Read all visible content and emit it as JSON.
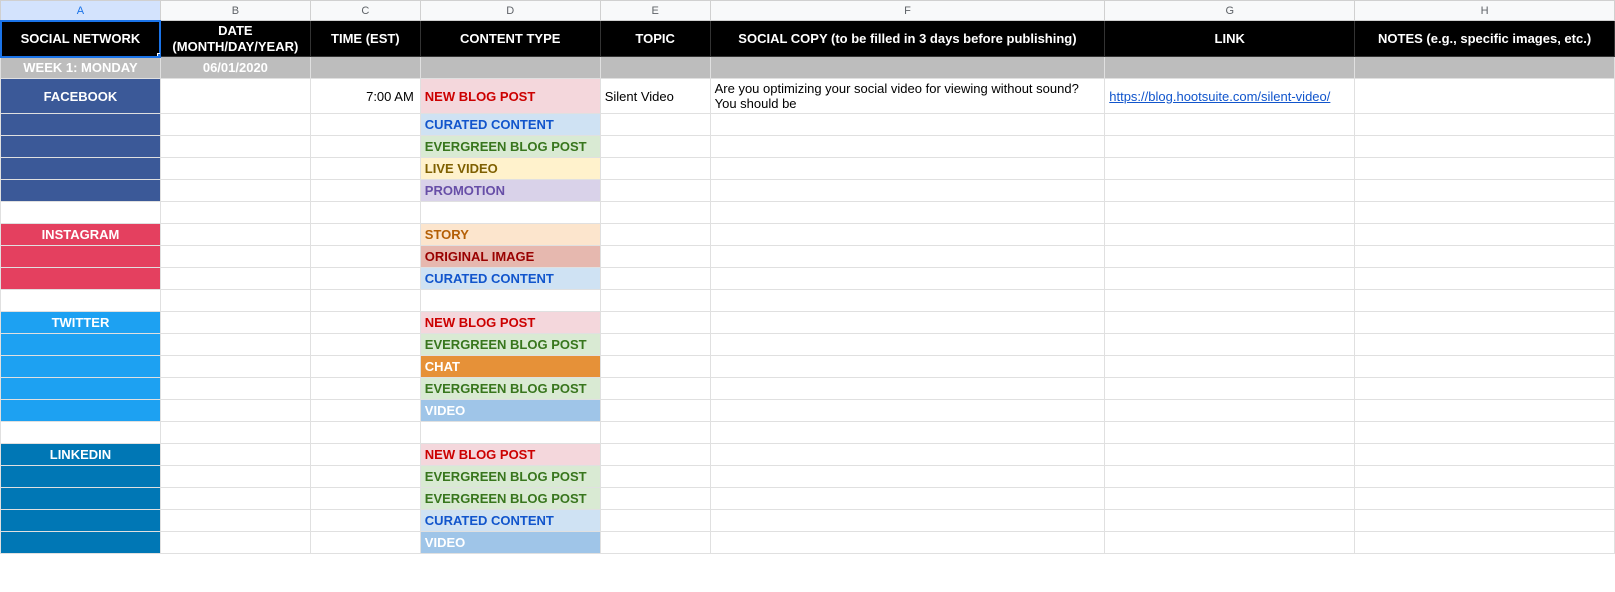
{
  "columns": {
    "A": "A",
    "B": "B",
    "C": "C",
    "D": "D",
    "E": "E",
    "F": "F",
    "G": "G",
    "H": "H"
  },
  "headers": {
    "A": "SOCIAL NETWORK",
    "B": "DATE (MONTH/DAY/YEAR)",
    "C": "TIME (EST)",
    "D": "CONTENT TYPE",
    "E": "TOPIC",
    "F": "SOCIAL COPY (to be filled in 3 days before publishing)",
    "G": "LINK",
    "H": "NOTES (e.g., specific images, etc.)"
  },
  "week": {
    "label": "WEEK 1: MONDAY",
    "date": "06/01/2020"
  },
  "networks": {
    "facebook": "FACEBOOK",
    "instagram": "INSTAGRAM",
    "twitter": "TWITTER",
    "linkedin": "LINKEDIN"
  },
  "content_types": {
    "newblog": "NEW BLOG POST",
    "curated": "CURATED CONTENT",
    "evergreen": "EVERGREEN BLOG POST",
    "livevideo": "LIVE VIDEO",
    "promotion": "PROMOTION",
    "story": "STORY",
    "origimage": "ORIGINAL IMAGE",
    "chat": "CHAT",
    "video": "VIDEO"
  },
  "rows": {
    "fb1": {
      "time": "7:00 AM",
      "topic": "Silent Video",
      "copy": "Are you optimizing your social video for viewing without sound? You should be",
      "link": "https://blog.hootsuite.com/silent-video/"
    }
  },
  "chart_data": {
    "type": "table",
    "title": "Social Media Content Calendar",
    "columns": [
      "SOCIAL NETWORK",
      "DATE (MONTH/DAY/YEAR)",
      "TIME (EST)",
      "CONTENT TYPE",
      "TOPIC",
      "SOCIAL COPY",
      "LINK",
      "NOTES"
    ],
    "sections": [
      {
        "week": "WEEK 1: MONDAY",
        "date": "06/01/2020",
        "networks": [
          {
            "name": "FACEBOOK",
            "posts": [
              {
                "time": "7:00 AM",
                "content_type": "NEW BLOG POST",
                "topic": "Silent Video",
                "copy": "Are you optimizing your social video for viewing without sound? You should be",
                "link": "https://blog.hootsuite.com/silent-video/"
              },
              {
                "content_type": "CURATED CONTENT"
              },
              {
                "content_type": "EVERGREEN BLOG POST"
              },
              {
                "content_type": "LIVE VIDEO"
              },
              {
                "content_type": "PROMOTION"
              }
            ]
          },
          {
            "name": "INSTAGRAM",
            "posts": [
              {
                "content_type": "STORY"
              },
              {
                "content_type": "ORIGINAL IMAGE"
              },
              {
                "content_type": "CURATED CONTENT"
              }
            ]
          },
          {
            "name": "TWITTER",
            "posts": [
              {
                "content_type": "NEW BLOG POST"
              },
              {
                "content_type": "EVERGREEN BLOG POST"
              },
              {
                "content_type": "CHAT"
              },
              {
                "content_type": "EVERGREEN BLOG POST"
              },
              {
                "content_type": "VIDEO"
              }
            ]
          },
          {
            "name": "LINKEDIN",
            "posts": [
              {
                "content_type": "NEW BLOG POST"
              },
              {
                "content_type": "EVERGREEN BLOG POST"
              },
              {
                "content_type": "EVERGREEN BLOG POST"
              },
              {
                "content_type": "CURATED CONTENT"
              },
              {
                "content_type": "VIDEO"
              }
            ]
          }
        ]
      }
    ]
  }
}
